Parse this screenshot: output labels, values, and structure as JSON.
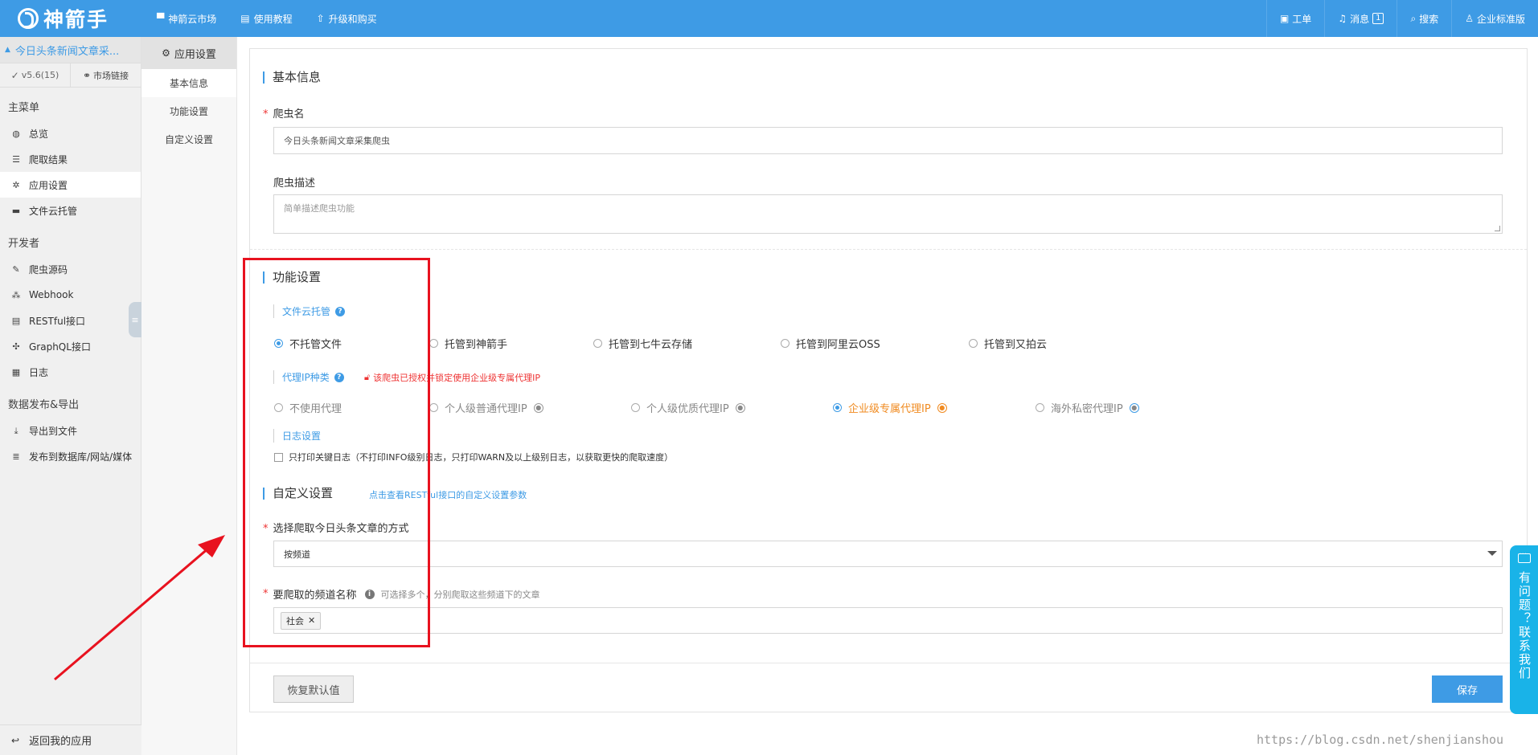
{
  "topbar": {
    "brand": "神箭手",
    "nav": [
      {
        "icon": "cloud-market-icon",
        "label": "神箭云市场"
      },
      {
        "icon": "book-icon",
        "label": "使用教程"
      },
      {
        "icon": "upgrade-icon",
        "label": "升级和购买"
      }
    ],
    "right": {
      "ticket": "工单",
      "message": "消息",
      "message_count": "1",
      "search": "搜索",
      "account": "企业标准版"
    }
  },
  "sidebar": {
    "app_name": "今日头条新闻文章采...",
    "version": "v5.6(15)",
    "market_link": "市场链接",
    "groups": [
      {
        "title": "主菜单",
        "items": [
          {
            "icon": "dashboard-icon",
            "label": "总览"
          },
          {
            "icon": "list-icon",
            "label": "爬取结果"
          },
          {
            "icon": "gear-icon",
            "label": "应用设置",
            "active": true
          },
          {
            "icon": "folder-icon",
            "label": "文件云托管"
          }
        ]
      },
      {
        "title": "开发者",
        "items": [
          {
            "icon": "edit-icon",
            "label": "爬虫源码"
          },
          {
            "icon": "webhook-icon",
            "label": "Webhook"
          },
          {
            "icon": "api-icon",
            "label": "RESTful接口"
          },
          {
            "icon": "graphql-icon",
            "label": "GraphQL接口"
          },
          {
            "icon": "calendar-icon",
            "label": "日志"
          }
        ]
      },
      {
        "title": "数据发布&导出",
        "items": [
          {
            "icon": "download-icon",
            "label": "导出到文件"
          },
          {
            "icon": "database-icon",
            "label": "发布到数据库/网站/媒体"
          }
        ]
      }
    ],
    "back": "返回我的应用"
  },
  "subnav": {
    "title": "应用设置",
    "items": [
      "基本信息",
      "功能设置",
      "自定义设置"
    ]
  },
  "basic": {
    "title": "基本信息",
    "name_label": "爬虫名",
    "name_value": "今日头条新闻文章采集爬虫",
    "desc_label": "爬虫描述",
    "desc_placeholder": "简单描述爬虫功能"
  },
  "feature": {
    "title": "功能设置",
    "file_hosting": {
      "label": "文件云托管",
      "options": [
        "不托管文件",
        "托管到神箭手",
        "托管到七牛云存储",
        "托管到阿里云OSS",
        "托管到又拍云"
      ],
      "selected": 0
    },
    "proxy": {
      "label": "代理IP种类",
      "lock_note": "该爬虫已授权并锁定使用企业级专属代理IP",
      "options": [
        "不使用代理",
        "个人级普通代理IP",
        "个人级优质代理IP",
        "企业级专属代理IP",
        "海外私密代理IP"
      ],
      "selected": 3
    },
    "log": {
      "label": "日志设置",
      "checkbox": "只打印关键日志（不打印INFO级别日志，只打印WARN及以上级别日志，以获取更快的爬取速度）"
    }
  },
  "custom": {
    "title": "自定义设置",
    "link": "点击查看RESTful接口的自定义设置参数",
    "mode_label": "选择爬取今日头条文章的方式",
    "mode_value": "按频道",
    "channel_label": "要爬取的频道名称",
    "channel_hint": "可选择多个，分别爬取这些频道下的文章",
    "channel_tags": [
      "社会"
    ]
  },
  "actions": {
    "reset": "恢复默认值",
    "save": "保存"
  },
  "float_help": "有问题？联系我们",
  "watermark": "https://blog.csdn.net/shenjianshou",
  "colors": {
    "brand": "#3e9be5",
    "annotation": "#e8121f",
    "float": "#19b3e8"
  }
}
